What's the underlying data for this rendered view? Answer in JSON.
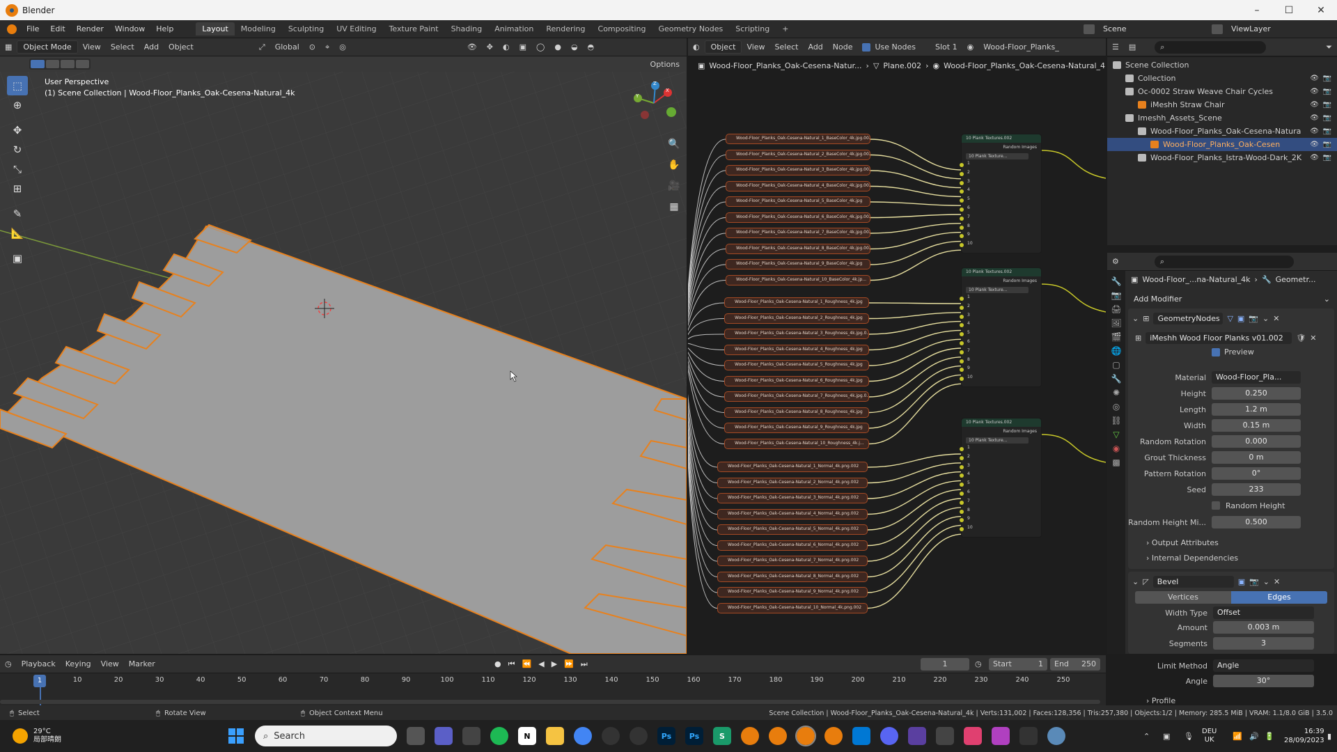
{
  "window": {
    "title": "Blender",
    "minimize": "–",
    "maximize": "☐",
    "close": "✕"
  },
  "menu": [
    "File",
    "Edit",
    "Render",
    "Window",
    "Help"
  ],
  "workspaces": [
    "Layout",
    "Modeling",
    "Sculpting",
    "UV Editing",
    "Texture Paint",
    "Shading",
    "Animation",
    "Rendering",
    "Compositing",
    "Geometry Nodes",
    "Scripting"
  ],
  "add_workspace": "+",
  "scene": {
    "name": "Scene",
    "view_layer": "ViewLayer"
  },
  "viewport": {
    "mode": "Object Mode",
    "menus": [
      "View",
      "Select",
      "Add",
      "Object"
    ],
    "orientation": "Global",
    "options": "Options",
    "overlay_title": "User Perspective",
    "overlay_sub": "(1) Scene Collection | Wood-Floor_Planks_Oak-Cesena-Natural_4k",
    "gizmo": {
      "x": "X",
      "y": "Y",
      "z": "Z"
    }
  },
  "node_editor": {
    "type": "Object",
    "menus": [
      "View",
      "Select",
      "Add",
      "Node"
    ],
    "use_nodes": "Use Nodes",
    "slot": "Slot 1",
    "material": "Wood-Floor_Planks_",
    "breadcrumb": [
      "Wood-Floor_Planks_Oak-Cesena-Natur...",
      "Plane.002",
      "Wood-Floor_Planks_Oak-Cesena-Natural_4..."
    ],
    "group_title": "10 Plank Textures.002",
    "group_out": "Random Images",
    "group_in": "10 Plank Texture...",
    "socket_numbers": [
      "1",
      "2",
      "3",
      "4",
      "5",
      "6",
      "7",
      "8",
      "9",
      "10"
    ],
    "basecolor_nodes": [
      "Wood-Floor_Planks_Oak-Cesena-Natural_1_BaseColor_4k.jpg.002",
      "Wood-Floor_Planks_Oak-Cesena-Natural_2_BaseColor_4k.jpg.002",
      "Wood-Floor_Planks_Oak-Cesena-Natural_3_BaseColor_4k.jpg.002",
      "Wood-Floor_Planks_Oak-Cesena-Natural_4_BaseColor_4k.jpg.002",
      "Wood-Floor_Planks_Oak-Cesena-Natural_5_BaseColor_4k.jpg",
      "Wood-Floor_Planks_Oak-Cesena-Natural_6_BaseColor_4k.jpg.002",
      "Wood-Floor_Planks_Oak-Cesena-Natural_7_BaseColor_4k.jpg.002",
      "Wood-Floor_Planks_Oak-Cesena-Natural_8_BaseColor_4k.jpg.002",
      "Wood-Floor_Planks_Oak-Cesena-Natural_9_BaseColor_4k.jpg",
      "Wood-Floor_Planks_Oak-Cesena-Natural_10_BaseColor_4k.jp..."
    ],
    "roughness_nodes": [
      "Wood-Floor_Planks_Oak-Cesena-Natural_1_Roughness_4k.jpg",
      "Wood-Floor_Planks_Oak-Cesena-Natural_2_Roughness_4k.jpg",
      "Wood-Floor_Planks_Oak-Cesena-Natural_3_Roughness_4k.jpg.0...",
      "Wood-Floor_Planks_Oak-Cesena-Natural_4_Roughness_4k.jpg",
      "Wood-Floor_Planks_Oak-Cesena-Natural_5_Roughness_4k.jpg",
      "Wood-Floor_Planks_Oak-Cesena-Natural_6_Roughness_4k.jpg",
      "Wood-Floor_Planks_Oak-Cesena-Natural_7_Roughness_4k.jpg.0...",
      "Wood-Floor_Planks_Oak-Cesena-Natural_8_Roughness_4k.jpg",
      "Wood-Floor_Planks_Oak-Cesena-Natural_9_Roughness_4k.jpg",
      "Wood-Floor_Planks_Oak-Cesena-Natural_10_Roughness_4k.j..."
    ],
    "normal_nodes": [
      "Wood-Floor_Planks_Oak-Cesena-Natural_1_Normal_4k.png.002",
      "Wood-Floor_Planks_Oak-Cesena-Natural_2_Normal_4k.png.002",
      "Wood-Floor_Planks_Oak-Cesena-Natural_3_Normal_4k.png.002",
      "Wood-Floor_Planks_Oak-Cesena-Natural_4_Normal_4k.png.002",
      "Wood-Floor_Planks_Oak-Cesena-Natural_5_Normal_4k.png.002",
      "Wood-Floor_Planks_Oak-Cesena-Natural_6_Normal_4k.png.002",
      "Wood-Floor_Planks_Oak-Cesena-Natural_7_Normal_4k.png.002",
      "Wood-Floor_Planks_Oak-Cesena-Natural_8_Normal_4k.png.002",
      "Wood-Floor_Planks_Oak-Cesena-Natural_9_Normal_4k.png.002",
      "Wood-Floor_Planks_Oak-Cesena-Natural_10_Normal_4k.png.002"
    ]
  },
  "outliner": {
    "rows": [
      {
        "label": "Scene Collection",
        "indent": 0
      },
      {
        "label": "Collection",
        "indent": 1
      },
      {
        "label": "Oc-0002 Straw Weave Chair Cycles",
        "indent": 1
      },
      {
        "label": "iMeshh Straw Chair",
        "indent": 2
      },
      {
        "label": "Imeshh_Assets_Scene",
        "indent": 1
      },
      {
        "label": "Wood-Floor_Planks_Oak-Cesena-Natura",
        "indent": 2
      },
      {
        "label": "Wood-Floor_Planks_Oak-Cesen",
        "indent": 3
      },
      {
        "label": "Wood-Floor_Planks_Istra-Wood-Dark_2K",
        "indent": 2
      }
    ]
  },
  "properties": {
    "breadcrumb_obj": "Wood-Floor_...na-Natural_4k",
    "breadcrumb_mod": "Geometr...",
    "add_modifier": "Add Modifier",
    "gn_modifier_name": "GeometryNodes",
    "node_group": "iMeshh Wood Floor Planks v01.002",
    "preview": "Preview",
    "fields": [
      {
        "label": "Material",
        "value": "Wood-Floor_Pla..."
      },
      {
        "label": "Height",
        "value": "0.250"
      },
      {
        "label": "Length",
        "value": "1.2 m"
      },
      {
        "label": "Width",
        "value": "0.15 m"
      },
      {
        "label": "Random Rotation",
        "value": "0.000"
      },
      {
        "label": "Grout Thickness",
        "value": "0 m"
      },
      {
        "label": "Pattern Rotation",
        "value": "0°"
      },
      {
        "label": "Seed",
        "value": "233"
      },
      {
        "label": "",
        "value": "Random Height"
      },
      {
        "label": "Random Height Mi...",
        "value": "0.500"
      }
    ],
    "output_attributes": "Output Attributes",
    "internal_dependencies": "Internal Dependencies",
    "bevel_name": "Bevel",
    "bevel_tabs": [
      "Vertices",
      "Edges"
    ],
    "bevel_fields": [
      {
        "label": "Width Type",
        "value": "Offset"
      },
      {
        "label": "Amount",
        "value": "0.003 m"
      },
      {
        "label": "Segments",
        "value": "3"
      },
      {
        "label": "Limit Method",
        "value": "Angle"
      },
      {
        "label": "Angle",
        "value": "30°"
      }
    ],
    "profile": "Profile"
  },
  "timeline": {
    "menus": [
      "Playback",
      "Keying",
      "View",
      "Marker"
    ],
    "current_frame": "1",
    "start_label": "Start",
    "start": "1",
    "end_label": "End",
    "end": "250",
    "ticks": [
      "1",
      "10",
      "20",
      "30",
      "40",
      "50",
      "60",
      "70",
      "80",
      "90",
      "100",
      "110",
      "120",
      "130",
      "140",
      "150",
      "160",
      "170",
      "180",
      "190",
      "200",
      "210",
      "220",
      "230",
      "240",
      "250"
    ]
  },
  "statusbar": {
    "select": "Select",
    "rotate": "Rotate View",
    "context": "Object Context Menu",
    "stats": "Scene Collection | Wood-Floor_Planks_Oak-Cesena-Natural_4k | Verts:131,002 | Faces:128,356 | Tris:257,380 | Objects:1/2 | Memory: 285.5 MiB | VRAM: 1.1/8.0 GiB | 3.5.0"
  },
  "taskbar": {
    "weather_temp": "29°C",
    "weather_desc": "局部晴朗",
    "search": "Search",
    "lang_top": "DEU",
    "lang_bottom": "UK",
    "time": "16:39",
    "date": "28/09/2023"
  },
  "colors": {
    "accent_orange": "#e87d0d",
    "selection_blue": "#334d80",
    "active_tab": "#4772b3",
    "node_link": "#e8e0a0"
  }
}
